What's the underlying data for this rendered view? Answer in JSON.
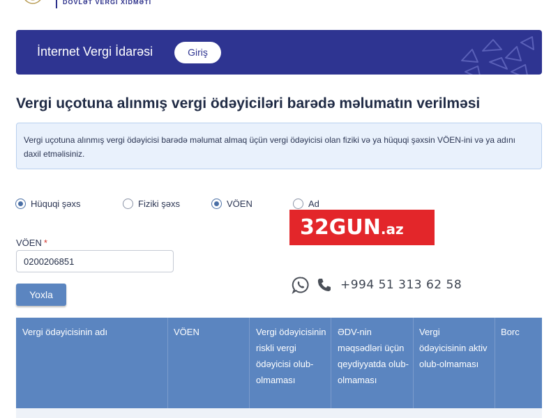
{
  "header": {
    "agency_name": "DÖVLƏT VERGİ XİDMƏTİ"
  },
  "banner": {
    "title": "İnternet Vergi İdarəsi",
    "login_label": "Giriş"
  },
  "page": {
    "title": "Vergi uçotuna alınmış vergi ödəyiciləri barədə məlumatın verilməsi"
  },
  "info": {
    "text": "Vergi uçotuna alınmış vergi ödəyicisi barədə məlumat almaq üçün vergi ödəyicisi olan fiziki və ya hüquqi şəxsin VÖEN-ini və ya adını daxil etməlisiniz."
  },
  "person_type": {
    "options": [
      {
        "label": "Hüquqi şəxs",
        "checked": true
      },
      {
        "label": "Fiziki şəxs",
        "checked": false
      }
    ]
  },
  "search_by": {
    "options": [
      {
        "label": "VÖEN",
        "checked": true
      },
      {
        "label": "Ad",
        "checked": false
      }
    ]
  },
  "form": {
    "voen_label": "VÖEN",
    "required_mark": "*",
    "voen_value": "0200206851",
    "submit_label": "Yoxla"
  },
  "overlay": {
    "watermark": "32GUN",
    "watermark_suffix": ".az",
    "phone": "+994 51 313 62 58"
  },
  "table": {
    "columns": [
      "Vergi ödəyicisinin adı",
      "VÖEN",
      "Vergi ödəyicisinin riskli vergi ödəyicisi olub-olmaması",
      "ƏDV-nin məqsədləri üçün qeydiyyatda olub-olmaması",
      "Vergi ödəyicisinin aktiv olub-olmaması",
      "Borc"
    ]
  },
  "colors": {
    "banner": "#2e3491",
    "accent": "#5b85c0",
    "watermark_bg": "#e3262a"
  }
}
